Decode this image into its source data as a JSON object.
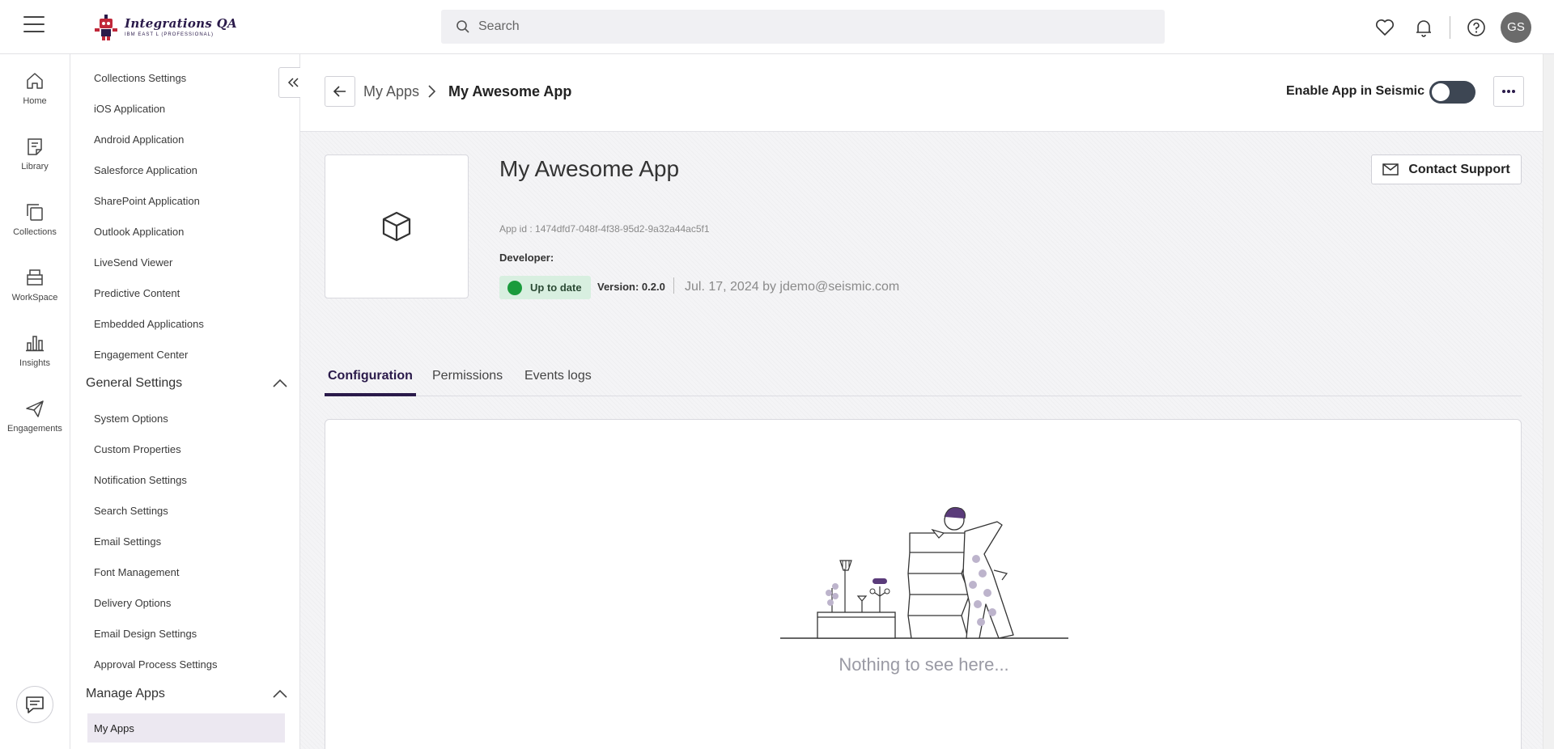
{
  "topbar": {
    "logo_title": "Integrations QA",
    "logo_subtitle": "IBM EAST L (PROFESSIONAL)",
    "search_placeholder": "Search",
    "avatar_initials": "GS"
  },
  "rail": {
    "items": [
      {
        "label": "Home",
        "icon": "home-icon"
      },
      {
        "label": "Library",
        "icon": "library-icon"
      },
      {
        "label": "Collections",
        "icon": "collections-icon"
      },
      {
        "label": "WorkSpace",
        "icon": "workspace-icon"
      },
      {
        "label": "Insights",
        "icon": "insights-icon"
      },
      {
        "label": "Engagements",
        "icon": "engagements-icon"
      }
    ]
  },
  "sidebar": {
    "top_items": [
      "Collections Settings",
      "iOS Application",
      "Android Application",
      "Salesforce Application",
      "SharePoint Application",
      "Outlook Application",
      "LiveSend Viewer",
      "Predictive Content",
      "Embedded Applications",
      "Engagement Center"
    ],
    "general_settings": {
      "label": "General Settings",
      "items": [
        "System Options",
        "Custom Properties",
        "Notification Settings",
        "Search Settings",
        "Email Settings",
        "Font Management",
        "Delivery Options",
        "Email Design Settings",
        "Approval Process Settings"
      ]
    },
    "manage_apps": {
      "label": "Manage Apps",
      "active_item": "My Apps"
    }
  },
  "header": {
    "breadcrumb_parent": "My Apps",
    "breadcrumb_current": "My Awesome App",
    "enable_label": "Enable App in Seismic",
    "enabled": false
  },
  "app": {
    "title": "My Awesome App",
    "app_id": "App id : 1474dfd7-048f-4f38-95d2-9a32a44ac5f1",
    "developer_label": "Developer:",
    "status": "Up to date",
    "status_color": "#1a9b3c",
    "version": "Version: 0.2.0",
    "updated": "Jul. 17, 2024 by jdemo@seismic.com",
    "contact_support": "Contact Support"
  },
  "tabs": [
    {
      "label": "Configuration",
      "active": true
    },
    {
      "label": "Permissions",
      "active": false
    },
    {
      "label": "Events logs",
      "active": false
    }
  ],
  "panel": {
    "empty_text": "Nothing to see here..."
  },
  "colors": {
    "accent": "#2a1a4a",
    "active_bg": "#ece8f1",
    "toggle_off": "#3d4653"
  }
}
